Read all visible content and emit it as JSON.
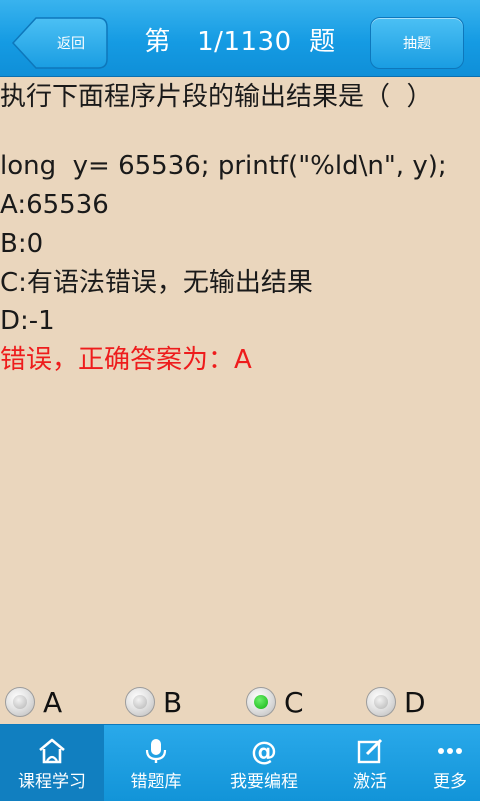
{
  "header": {
    "back_label": "返回",
    "title": "第   1/1130  题",
    "draw_label": "抽题"
  },
  "question": {
    "title": "执行下面程序片段的输出结果是（  ）",
    "code": "long  y= 65536; printf(\"%ld\\n\", y);",
    "options": [
      "A:65536",
      "B:0",
      "C:有语法错误，无输出结果",
      "D:-1"
    ],
    "result": "错误，正确答案为：A"
  },
  "answers": {
    "choices": [
      "A",
      "B",
      "C",
      "D"
    ],
    "selected": "C"
  },
  "nav": {
    "items": [
      {
        "label": "课程学习",
        "icon": "home-icon"
      },
      {
        "label": "错题库",
        "icon": "microphone-icon"
      },
      {
        "label": "我要编程",
        "icon": "at-icon"
      },
      {
        "label": "激活",
        "icon": "edit-icon"
      },
      {
        "label": "更多",
        "icon": "more-icon"
      }
    ],
    "active_index": 0
  },
  "colors": {
    "header_bg": "#159be3",
    "page_bg": "#ead6bd",
    "error_text": "#ee1c1c",
    "selected_radio": "#13b313"
  }
}
